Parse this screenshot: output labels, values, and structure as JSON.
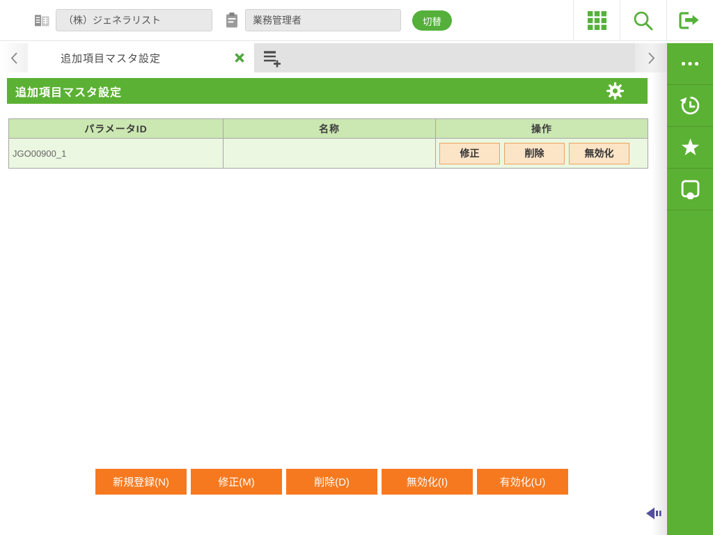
{
  "topbar": {
    "company_value": "（株）ジェネラリスト",
    "role_value": "業務管理者",
    "switch_button": "切替",
    "icons": [
      "company-building",
      "clipboard",
      "apps-grid",
      "search",
      "logout"
    ]
  },
  "tabbar": {
    "active_tab": "追加項目マスタ設定",
    "icons": [
      "chevron-left",
      "close-x",
      "add-tab-list-plus",
      "chevron-right"
    ]
  },
  "panel": {
    "title": "追加項目マスタ設定",
    "icons": [
      "gear"
    ]
  },
  "table": {
    "columns": [
      "パラメータID",
      "名称",
      "操作"
    ],
    "rows": [
      {
        "parameter_id": "JGO00900_1",
        "name": "",
        "actions": [
          "修正",
          "削除",
          "無効化"
        ]
      }
    ]
  },
  "footer": {
    "buttons": [
      "新規登録(N)",
      "修正(M)",
      "削除(D)",
      "無効化(I)",
      "有効化(U)"
    ]
  },
  "sidebar": {
    "icons": [
      "more-ellipsis",
      "history-clock",
      "favorite-star",
      "feedback-tray"
    ],
    "collapse_icon": "collapse-left-arrow"
  },
  "colors": {
    "green": "#5bb133",
    "green_icon": "#55b13a",
    "orange": "#f6791f",
    "row_button_bg": "#fce4c6",
    "row_button_border": "#eda261",
    "table_header_bg": "#cbe7b2",
    "table_row_bg": "#ebf7e0",
    "table_border": "#a6a6a6",
    "tabbar_bg": "#e2e2e2",
    "input_bg": "#e9e9e9",
    "collapse_arrow": "#54509d"
  }
}
